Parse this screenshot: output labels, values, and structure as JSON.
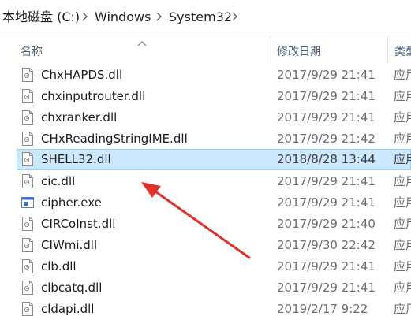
{
  "breadcrumb": {
    "items": [
      {
        "label": "本地磁盘 (C:)"
      },
      {
        "label": "Windows"
      },
      {
        "label": "System32"
      }
    ]
  },
  "columns": {
    "name": "名称",
    "modified": "修改日期",
    "type": "类型"
  },
  "files": [
    {
      "name": "ChxHAPDS.dll",
      "modified": "2017/9/29 21:41",
      "type": "应用",
      "icon": "dll-file-icon"
    },
    {
      "name": "chxinputrouter.dll",
      "modified": "2017/9/29 21:41",
      "type": "应用",
      "icon": "dll-file-icon"
    },
    {
      "name": "chxranker.dll",
      "modified": "2017/9/29 21:41",
      "type": "应用",
      "icon": "dll-file-icon"
    },
    {
      "name": "CHxReadingStringIME.dll",
      "modified": "2017/9/29 21:42",
      "type": "应用",
      "icon": "dll-file-icon"
    },
    {
      "name": "SHELL32.dll",
      "modified": "2018/8/28 13:44",
      "type": "应用",
      "icon": "dll-file-icon",
      "selected": true
    },
    {
      "name": "cic.dll",
      "modified": "2017/9/29 21:41",
      "type": "应用",
      "icon": "dll-file-icon"
    },
    {
      "name": "cipher.exe",
      "modified": "2017/9/29 21:41",
      "type": "应用",
      "icon": "exe-file-icon"
    },
    {
      "name": "CIRCoInst.dll",
      "modified": "2017/9/29 21:40",
      "type": "应用",
      "icon": "dll-file-icon"
    },
    {
      "name": "CIWmi.dll",
      "modified": "2017/9/30 22:42",
      "type": "应用",
      "icon": "dll-file-icon"
    },
    {
      "name": "clb.dll",
      "modified": "2017/9/29 21:41",
      "type": "应用",
      "icon": "dll-file-icon"
    },
    {
      "name": "clbcatq.dll",
      "modified": "2017/9/29 21:41",
      "type": "应用",
      "icon": "dll-file-icon"
    },
    {
      "name": "cldapi.dll",
      "modified": "2019/2/17 9:22",
      "type": "应用",
      "icon": "dll-file-icon"
    }
  ],
  "colors": {
    "selection_bg": "#cce8ff",
    "selection_border": "#99d1ff",
    "header_text": "#4d6082",
    "annotation_arrow": "#e0302a"
  }
}
